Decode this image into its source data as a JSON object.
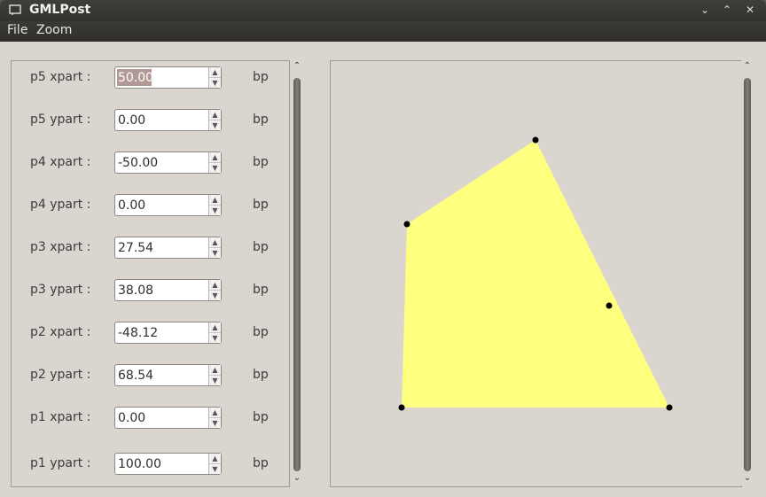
{
  "window": {
    "title": "GMLPost"
  },
  "title_buttons": {
    "minimize": "⌄",
    "maximize": "⌃",
    "close": "✕"
  },
  "menu": {
    "file": "File",
    "zoom": "Zoom"
  },
  "fields": [
    {
      "label": "p5 xpart :",
      "value": "50.00",
      "unit": "bp"
    },
    {
      "label": "p5 ypart :",
      "value": "0.00",
      "unit": "bp"
    },
    {
      "label": "p4 xpart :",
      "value": "-50.00",
      "unit": "bp"
    },
    {
      "label": "p4 ypart :",
      "value": "0.00",
      "unit": "bp"
    },
    {
      "label": "p3 xpart :",
      "value": "27.54",
      "unit": "bp"
    },
    {
      "label": "p3 ypart :",
      "value": "38.08",
      "unit": "bp"
    },
    {
      "label": "p2 xpart :",
      "value": "-48.12",
      "unit": "bp"
    },
    {
      "label": "p2 ypart :",
      "value": "68.54",
      "unit": "bp"
    },
    {
      "label": "p1 xpart :",
      "value": "0.00",
      "unit": "bp"
    },
    {
      "label": "p1 ypart :",
      "value": "100.00",
      "unit": "bp"
    }
  ],
  "scroll_arrows": {
    "up": "⌃",
    "down": "⌄"
  },
  "canvas": {
    "fill_color": "#ffff80",
    "point_color": "#000000"
  },
  "colors": {
    "titlebar": "#3a3936",
    "window_bg": "#dad6cf",
    "selection": "#b19a95"
  }
}
